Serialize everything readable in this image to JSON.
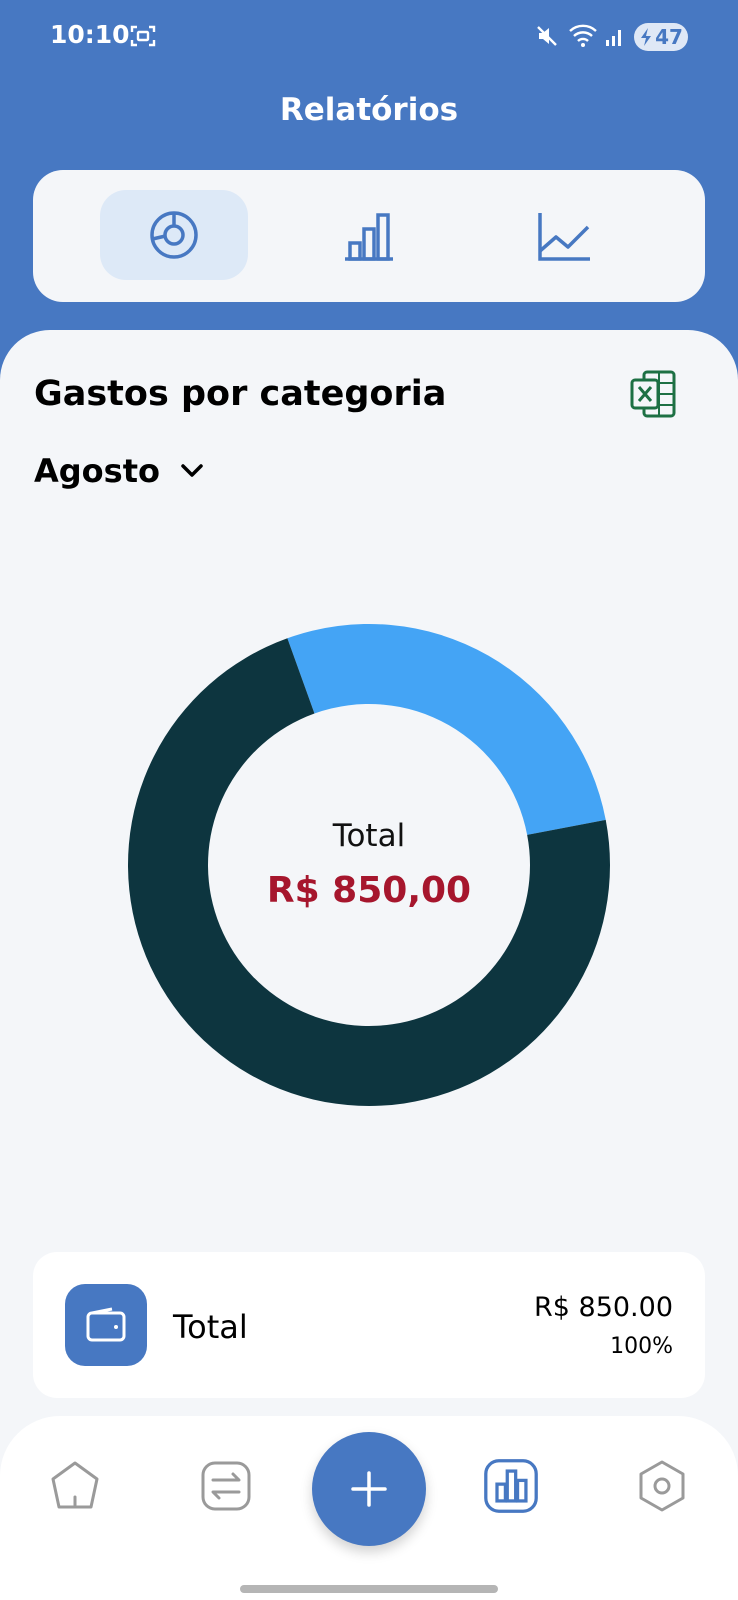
{
  "status_bar": {
    "time": "10:10",
    "battery": "47"
  },
  "header": {
    "title": "Relatórios"
  },
  "chart_tabs": [
    {
      "icon": "donut-chart-icon",
      "active": true
    },
    {
      "icon": "bar-chart-icon",
      "active": false
    },
    {
      "icon": "line-chart-icon",
      "active": false
    }
  ],
  "section": {
    "title": "Gastos por categoria",
    "export_icon": "excel-icon",
    "month": "Agosto"
  },
  "chart_data": {
    "type": "pie",
    "donut": true,
    "center_label": "Total",
    "center_value": "R$ 850,00",
    "slices": [
      {
        "value": 0.275,
        "color": "#44a4f5"
      },
      {
        "value": 0.725,
        "color": "#0d353f"
      }
    ]
  },
  "summary_card": {
    "icon": "wallet-icon",
    "label": "Total",
    "amount": "R$ 850.00",
    "percent": "100%"
  },
  "bottom_nav": [
    {
      "icon": "home-icon"
    },
    {
      "icon": "transfer-icon"
    },
    {
      "icon": "add-icon"
    },
    {
      "icon": "reports-icon",
      "active": true
    },
    {
      "icon": "settings-icon"
    }
  ],
  "colors": {
    "primary": "#4778c2",
    "value_red": "#a6162d",
    "background": "#f4f6f9"
  }
}
